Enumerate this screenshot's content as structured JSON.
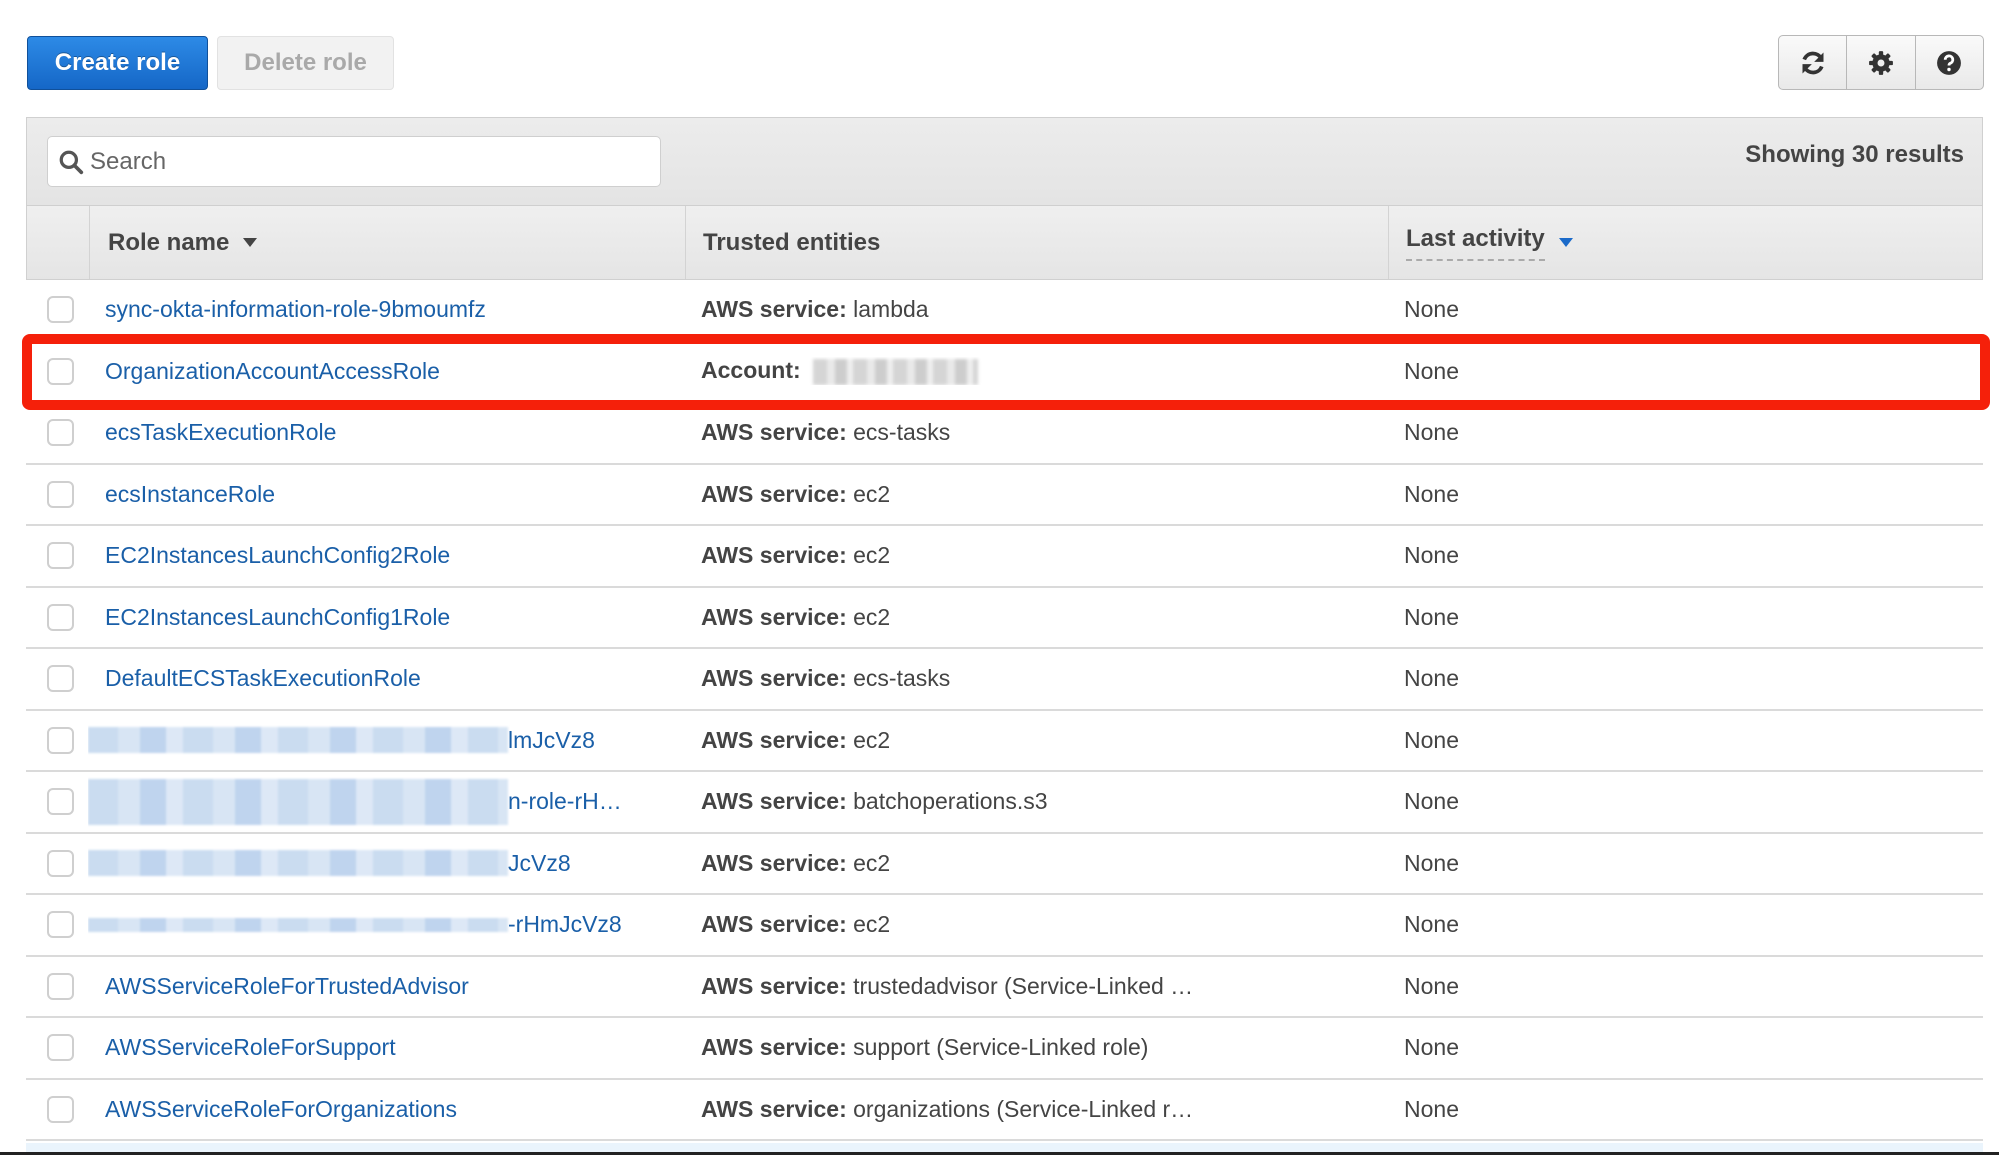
{
  "toolbar": {
    "create_label": "Create role",
    "delete_label": "Delete role",
    "icons": [
      "refresh-icon",
      "gear-icon",
      "help-icon"
    ]
  },
  "search": {
    "placeholder": "Search",
    "value": ""
  },
  "results_label": "Showing 30 results",
  "columns": {
    "role_name": "Role name",
    "trusted_entities": "Trusted entities",
    "last_activity": "Last activity"
  },
  "rows": [
    {
      "name": "sync-okta-information-role-9bmoumfz",
      "entity_label": "AWS service:",
      "entity_value": "lambda",
      "last_activity": "None"
    },
    {
      "name": "OrganizationAccountAccessRole",
      "entity_label": "Account:",
      "entity_value": "",
      "last_activity": "None",
      "entity_redacted": true,
      "highlighted": true
    },
    {
      "name": "ecsTaskExecutionRole",
      "entity_label": "AWS service:",
      "entity_value": "ecs-tasks",
      "last_activity": "None"
    },
    {
      "name": "ecsInstanceRole",
      "entity_label": "AWS service:",
      "entity_value": "ec2",
      "last_activity": "None"
    },
    {
      "name": "EC2InstancesLaunchConfig2Role",
      "entity_label": "AWS service:",
      "entity_value": "ec2",
      "last_activity": "None"
    },
    {
      "name": "EC2InstancesLaunchConfig1Role",
      "entity_label": "AWS service:",
      "entity_value": "ec2",
      "last_activity": "None"
    },
    {
      "name": "DefaultECSTaskExecutionRole",
      "entity_label": "AWS service:",
      "entity_value": "ecs-tasks",
      "last_activity": "None"
    },
    {
      "name": "lmJcVz8",
      "name_redacted": true,
      "entity_label": "AWS service:",
      "entity_value": "ec2",
      "last_activity": "None"
    },
    {
      "name": "n-role-rH…",
      "name_redacted": true,
      "entity_label": "AWS service:",
      "entity_value": "batchoperations.s3",
      "last_activity": "None"
    },
    {
      "name": "JcVz8",
      "name_redacted": true,
      "entity_label": "AWS service:",
      "entity_value": "ec2",
      "last_activity": "None"
    },
    {
      "name": "-rHmJcVz8",
      "name_redacted": true,
      "entity_label": "AWS service:",
      "entity_value": "ec2",
      "last_activity": "None"
    },
    {
      "name": "AWSServiceRoleForTrustedAdvisor",
      "entity_label": "AWS service:",
      "entity_value": "trustedadvisor",
      "entity_note": "(Service-Linked …",
      "last_activity": "None"
    },
    {
      "name": "AWSServiceRoleForSupport",
      "entity_label": "AWS service:",
      "entity_value": "support",
      "entity_note": "(Service-Linked role)",
      "last_activity": "None"
    },
    {
      "name": "AWSServiceRoleForOrganizations",
      "entity_label": "AWS service:",
      "entity_value": "organizations",
      "entity_note": "(Service-Linked r…",
      "last_activity": "None"
    }
  ],
  "colors": {
    "primary_button": "#1a73d1",
    "link": "#1a5fa8",
    "highlight": "#f5200a"
  }
}
